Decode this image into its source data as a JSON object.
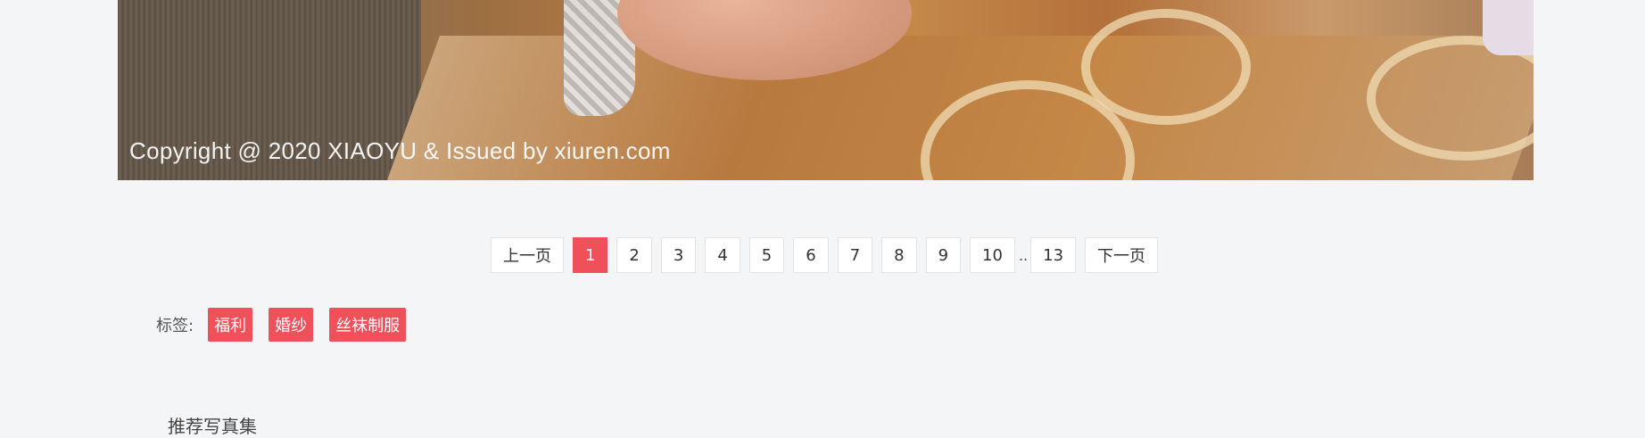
{
  "photo": {
    "copyright": "Copyright @ 2020 XIAOYU & Issued by xiuren.com"
  },
  "pagination": {
    "prev": "上一页",
    "pages": [
      "1",
      "2",
      "3",
      "4",
      "5",
      "6",
      "7",
      "8",
      "9",
      "10"
    ],
    "ellipsis": "..",
    "last": "13",
    "next": "下一页",
    "active": "1",
    "accent_color": "#f0505a"
  },
  "tags": {
    "label": "标签:",
    "items": [
      "福利",
      "婚纱",
      "丝袜制服"
    ]
  },
  "recommend": {
    "title": "推荐写真集"
  }
}
